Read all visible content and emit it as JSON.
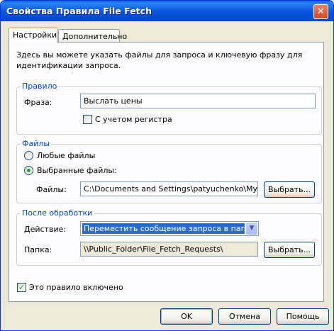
{
  "window": {
    "title": "Свойства Правила File Fetch",
    "close_glyph": "✕"
  },
  "tabs": [
    {
      "label": "Настройки"
    },
    {
      "label": "Дополнительно"
    }
  ],
  "intro": "Здесь вы можете указать файлы для запроса и ключевую фразу для идентификации запроса.",
  "rule": {
    "group_label": "Правило",
    "phrase_label": "Фраза:",
    "phrase_value": "Выслать цены",
    "case_label": "С учетом регистра",
    "case_checked": false
  },
  "files": {
    "group_label": "Файлы",
    "any_label": "Любые файлы",
    "selected_label": "Выбранные файлы:",
    "selected": "selected",
    "files_label": "Файлы:",
    "files_value": "C:\\Documents and Settings\\patyuchenko\\My Doc",
    "browse_label": "Выбрать..."
  },
  "after": {
    "group_label": "После обработки",
    "action_label": "Действие:",
    "action_value": "Переместить сообщение запроса в папку",
    "folder_label": "Папка:",
    "folder_value": "\\\\Public_Folder\\File_Fetch_Requests\\",
    "browse_label": "Выбрать..."
  },
  "enabled": {
    "label": "Это правило включено",
    "checked": true,
    "check_glyph": "✓"
  },
  "buttons": {
    "ok": "OK",
    "cancel": "Отмена",
    "help": "Помощь"
  }
}
